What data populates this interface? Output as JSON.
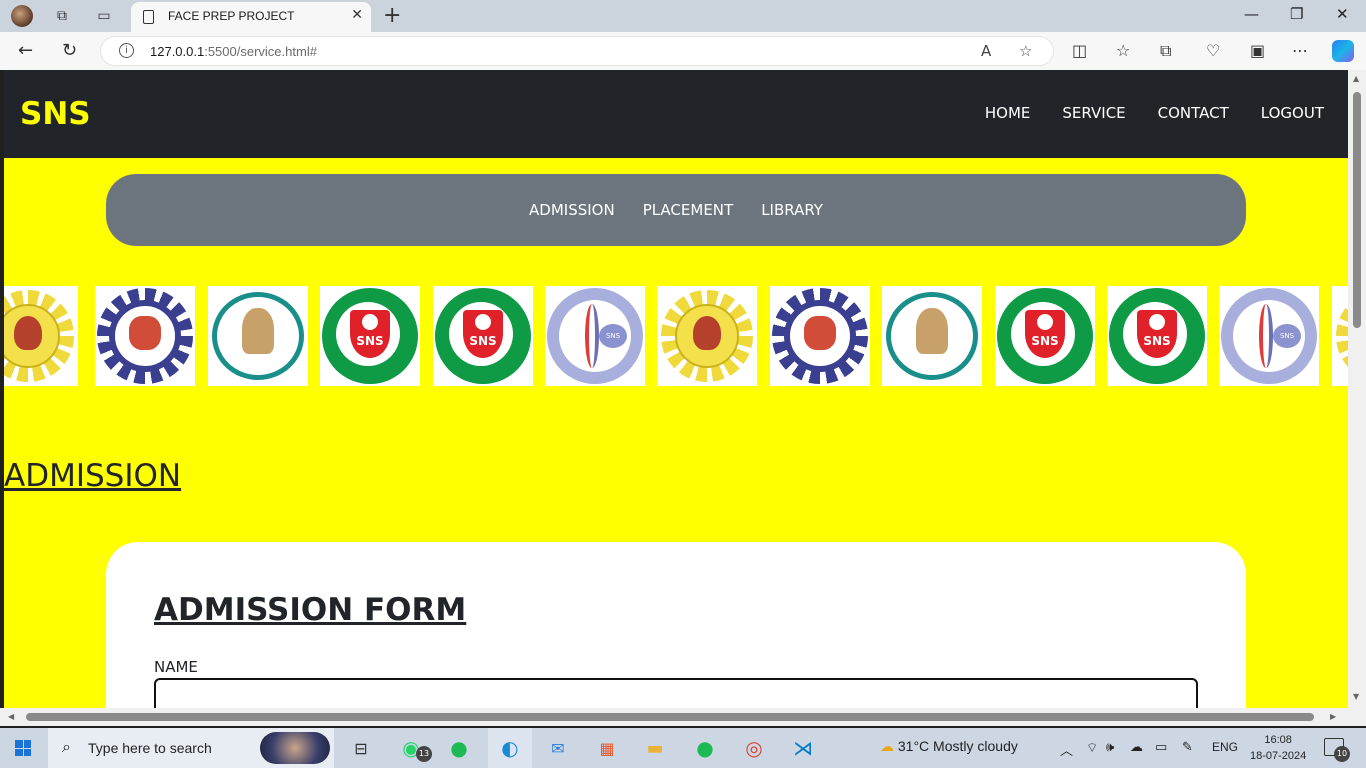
{
  "browser": {
    "tab_title": "FACE PREP PROJECT",
    "url_host": "127.0.0.1",
    "url_rest": ":5500/service.html#"
  },
  "page": {
    "brand": "SNS",
    "nav": [
      "HOME",
      "SERVICE",
      "CONTACT",
      "LOGOUT"
    ],
    "subnav": [
      "ADMISSION",
      "PLACEMENT",
      "LIBRARY"
    ],
    "carousel_logo_text": {
      "pharmacy": "SNS",
      "physio": "SNS"
    },
    "section_heading": "ADMISSION",
    "form": {
      "title": "ADMISSION FORM",
      "name_label": "NAME",
      "name_value": ""
    }
  },
  "taskbar": {
    "search_placeholder": "Type here to search",
    "whatsapp_badge": "13",
    "weather": "31°C  Mostly cloudy",
    "language": "ENG",
    "time": "16:08",
    "date": "18-07-2024",
    "notification_count": "10"
  }
}
